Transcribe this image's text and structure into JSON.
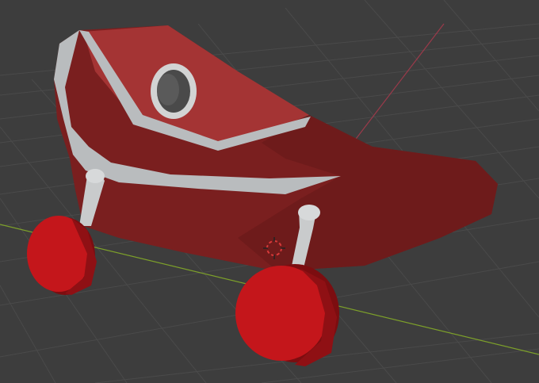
{
  "viewport": {
    "mode": "3d-viewport",
    "background_color": "#3d3d3d",
    "grid_line_color": "#4a4a4a",
    "x_axis_color": "#7da02a",
    "y_axis_color": "#9a3a4a"
  },
  "model": {
    "body_color": "#7a1f1f",
    "body_light_color": "#a43434",
    "trim_color": "#b9bcbe",
    "porthole_color": "#d2d3d3",
    "wheel_color": "#c4161b",
    "wheel_dark_color": "#7c0d10",
    "strut_color": "#c9cbcc"
  },
  "cursor": {
    "icon": "3d-cursor-icon",
    "ring_color": "#d83a3a"
  }
}
